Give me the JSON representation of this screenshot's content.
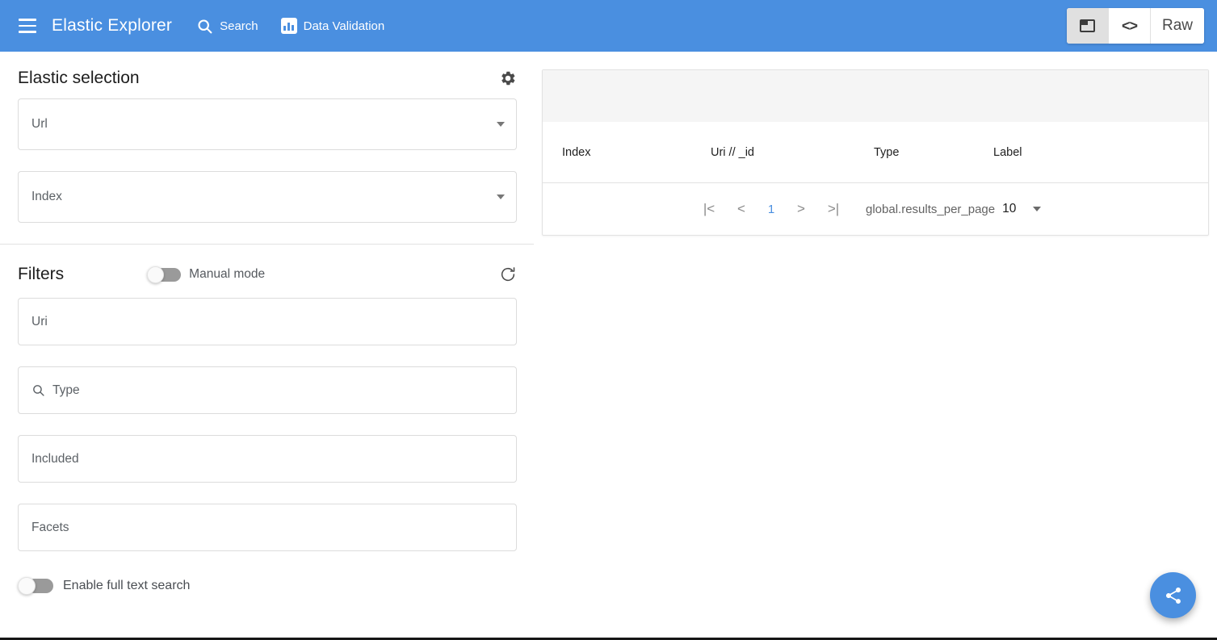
{
  "appbar": {
    "menu_icon": "hamburger-menu-icon",
    "brand": "Elastic Explorer",
    "nav": [
      {
        "label": "Search",
        "icon": "search-icon"
      },
      {
        "label": "Data Validation",
        "icon": "bar-chart-icon"
      }
    ],
    "view_modes": [
      {
        "label": "",
        "icon": "card-view-icon",
        "active": true
      },
      {
        "label": "",
        "icon": "code-view-icon",
        "active": false
      },
      {
        "label": "Raw",
        "icon": "",
        "active": false
      }
    ],
    "accent_color": "#4a8fe0"
  },
  "elastic_selection": {
    "title": "Elastic selection",
    "settings_icon": "gear-icon",
    "fields": [
      {
        "name": "url",
        "placeholder": "Url",
        "value": "",
        "type": "select"
      },
      {
        "name": "index",
        "placeholder": "Index",
        "value": "",
        "type": "select"
      }
    ]
  },
  "filters": {
    "title": "Filters",
    "manual_mode": {
      "label": "Manual mode",
      "enabled": false
    },
    "refresh_icon": "refresh-icon",
    "fields": [
      {
        "name": "uri",
        "placeholder": "Uri",
        "value": "",
        "icon": ""
      },
      {
        "name": "type",
        "placeholder": "Type",
        "value": "",
        "icon": "search-icon"
      },
      {
        "name": "included",
        "placeholder": "Included",
        "value": "",
        "icon": ""
      },
      {
        "name": "facets",
        "placeholder": "Facets",
        "value": "",
        "icon": ""
      }
    ],
    "full_text_search": {
      "label": "Enable full text search",
      "enabled": false
    }
  },
  "results_table": {
    "columns": [
      "Index",
      "Uri // _id",
      "Type",
      "Label"
    ],
    "rows": [],
    "pagination": {
      "first_label": "|<",
      "prev_label": "<",
      "current_page": "1",
      "next_label": ">",
      "last_label": ">|",
      "results_per_page_label": "global.results_per_page",
      "results_per_page_value": "10"
    }
  },
  "fab": {
    "icon": "share-icon",
    "color": "#4a8fe0"
  }
}
